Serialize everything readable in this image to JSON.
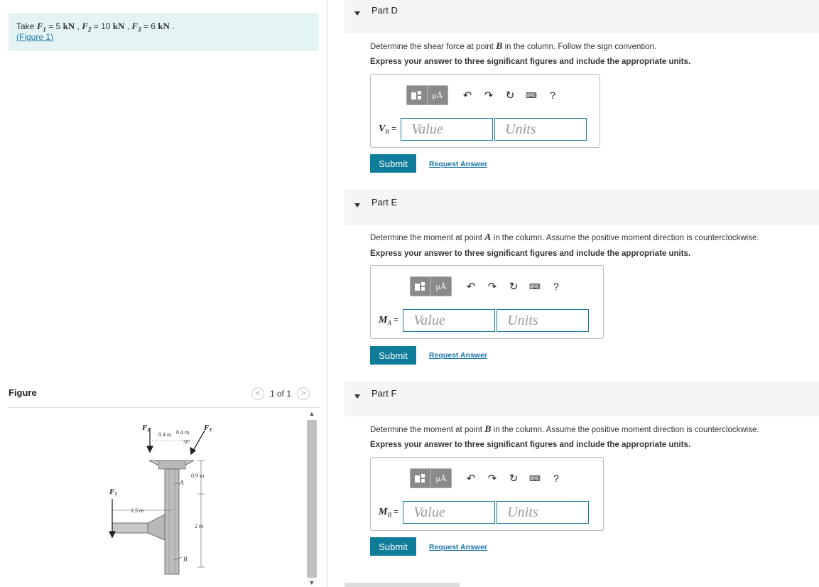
{
  "given": {
    "take_label": "Take",
    "f1": "F",
    "f1_sub": "1",
    "f1_val": "= 5",
    "f1_unit": "kN",
    "f2": "F",
    "f2_sub": "2",
    "f2_val": "= 10",
    "f2_unit": "kN",
    "f3": "F",
    "f3_sub": "3",
    "f3_val": "= 6",
    "f3_unit": "kN",
    "figure_link": "Figure 1"
  },
  "figure": {
    "title": "Figure",
    "pager": "1 of 1",
    "labels": {
      "F2": "F",
      "F2_sub": "2",
      "F3": "F",
      "F3_sub": "3",
      "F1": "F",
      "F1_sub": "1",
      "d1": "0.4 m",
      "d2": "0.4 m",
      "angle": "30°",
      "h1": "0.9 m",
      "A": "A",
      "w": "1.5 m",
      "h2": "2 m",
      "B": "B"
    }
  },
  "parts": [
    {
      "title": "Part D",
      "question_pre": "Determine the shear force at point",
      "question_var": "B",
      "question_post": "in the column. Follow the sign convention.",
      "instruction": "Express your answer to three significant figures and include the appropriate units.",
      "var_label": "V",
      "var_sub": "B",
      "value_placeholder": "Value",
      "units_placeholder": "Units",
      "submit": "Submit",
      "request": "Request Answer"
    },
    {
      "title": "Part E",
      "question_pre": "Determine the moment at point",
      "question_var": "A",
      "question_post": "in the column. Assume the positive moment direction is counterclockwise.",
      "instruction": "Express your answer to three significant figures and include the appropriate units.",
      "var_label": "M",
      "var_sub": "A",
      "value_placeholder": "Value",
      "units_placeholder": "Units",
      "submit": "Submit",
      "request": "Request Answer"
    },
    {
      "title": "Part F",
      "question_pre": "Determine the moment at point",
      "question_var": "B",
      "question_post": "in the column. Assume the positive moment direction is counterclockwise.",
      "instruction": "Express your answer to three significant figures and include the appropriate units.",
      "var_label": "M",
      "var_sub": "B",
      "value_placeholder": "Value",
      "units_placeholder": "Units",
      "submit": "Submit",
      "request": "Request Answer"
    }
  ],
  "toolbar": {
    "mu_label": "μÅ",
    "undo": "↶",
    "redo": "↷",
    "reset": "↻",
    "keyboard": "⌨",
    "help": "?"
  }
}
